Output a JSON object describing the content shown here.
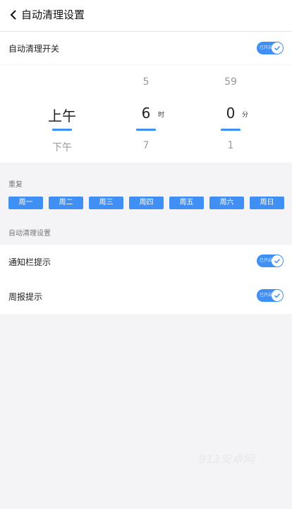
{
  "header": {
    "title": "自动清理设置"
  },
  "auto_clean": {
    "label": "自动清理开关",
    "toggle_text": "已开启"
  },
  "picker": {
    "period": {
      "above": "",
      "selected": "上午",
      "below": "下午"
    },
    "hour": {
      "above": "5",
      "selected": "6",
      "below": "7",
      "unit": "时"
    },
    "minute": {
      "above": "59",
      "selected": "0",
      "below": "1",
      "unit": "分"
    }
  },
  "repeat": {
    "label": "重复",
    "days": [
      "周一",
      "周二",
      "周三",
      "周四",
      "周五",
      "周六",
      "周日"
    ]
  },
  "settings": {
    "section_label": "自动清理设置",
    "notification": {
      "label": "通知栏提示",
      "toggle_text": "已开启"
    },
    "weekly_report": {
      "label": "周报提示",
      "toggle_text": "已开启"
    }
  },
  "watermark": "913安卓网",
  "colors": {
    "accent": "#3f8ff5",
    "background": "#f4f4f6"
  }
}
